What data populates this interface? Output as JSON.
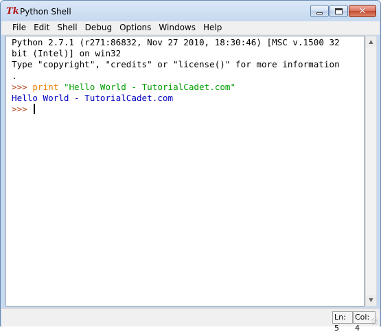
{
  "window": {
    "app_icon": "Tk",
    "title": "Python Shell",
    "controls": {
      "minimize": "minimize-icon",
      "maximize": "maximize-icon",
      "close": "close-icon"
    }
  },
  "menu": [
    "File",
    "Edit",
    "Shell",
    "Debug",
    "Options",
    "Windows",
    "Help"
  ],
  "console": {
    "banner_line1": "Python 2.7.1 (r271:86832, Nov 27 2010, 18:30:46) [MSC v.1500 32",
    "banner_line2": "bit (Intel)] on win32",
    "banner_line3": "Type \"copyright\", \"credits\" or \"license()\" for more information",
    "banner_line4": ".",
    "prompt": ">>> ",
    "command_keyword": "print",
    "command_string": "\"Hello World - TutorialCadet.com\"",
    "output": "Hello World - TutorialCadet.com",
    "prompt2": ">>> "
  },
  "status": {
    "line": "Ln: 5",
    "column": "Col: 4"
  },
  "colors": {
    "prompt": "#b8431a",
    "keyword": "#f08000",
    "string": "#00a000",
    "output": "#0000c0"
  }
}
